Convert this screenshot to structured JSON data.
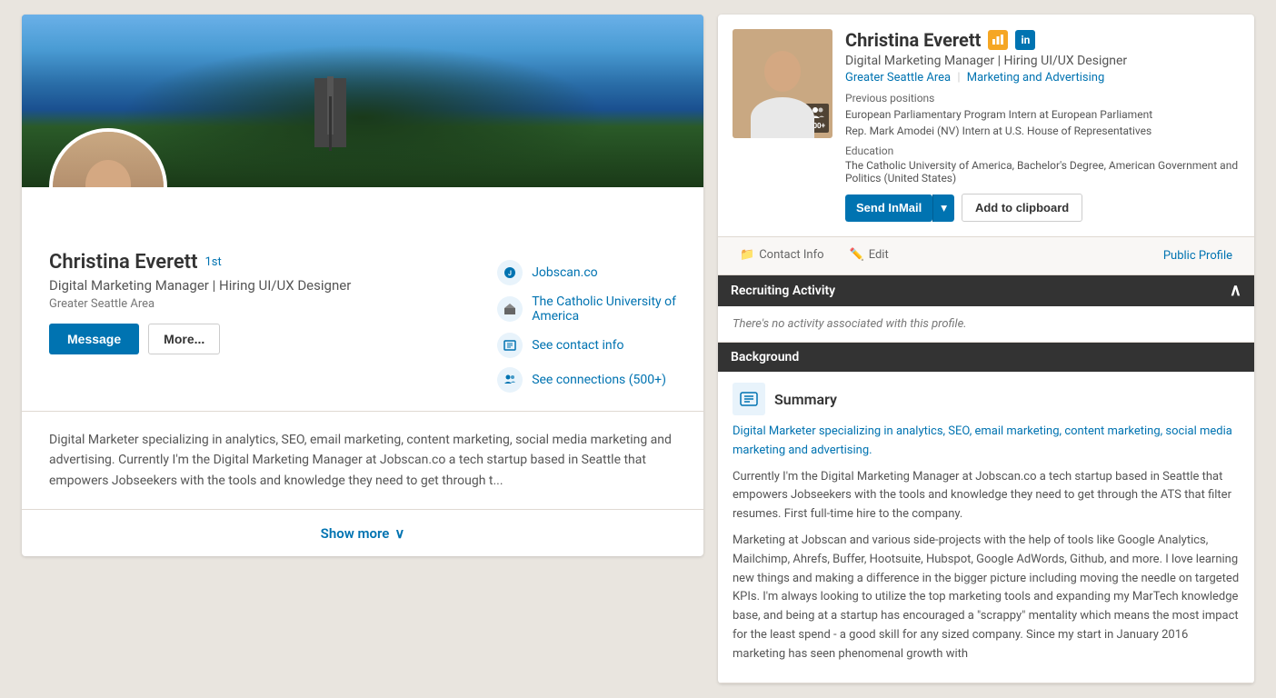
{
  "left": {
    "name": "Christina Everett",
    "connection": "1st",
    "headline": "Digital Marketing Manager | Hiring UI/UX Designer",
    "location": "Greater Seattle Area",
    "actions": {
      "message": "Message",
      "more": "More..."
    },
    "sidebar_links": [
      {
        "id": "jobscan",
        "label": "Jobscan.co",
        "icon": "🔵"
      },
      {
        "id": "university",
        "label": "The Catholic University of America",
        "icon": "🏛"
      },
      {
        "id": "contact",
        "label": "See contact info",
        "icon": "📋"
      },
      {
        "id": "connections",
        "label": "See connections (500+)",
        "icon": "👥"
      }
    ],
    "summary": "Digital Marketer specializing in analytics, SEO, email marketing, content marketing, social media marketing and advertising. Currently I'm the Digital Marketing Manager at Jobscan.co a tech startup based in Seattle that empowers Jobseekers with the tools and knowledge they need to get through t...",
    "show_more": "Show more"
  },
  "right": {
    "name": "Christina Everett",
    "headline": "Digital Marketing Manager | Hiring UI/UX Designer",
    "location_area": "Greater Seattle Area",
    "location_industry": "Marketing and Advertising",
    "previous_positions_label": "Previous positions",
    "previous_positions": [
      "European Parliamentary Program Intern at European Parliament",
      "Rep. Mark Amodei (NV) Intern at U.S. House of Representatives"
    ],
    "education_label": "Education",
    "education_text": "The Catholic University of America, Bachelor's Degree, American Government and Politics (United States)",
    "connections_count": "500+",
    "buttons": {
      "send_inmail": "Send InMail",
      "add_to_clipboard": "Add to clipboard"
    },
    "tabs": {
      "contact_info": "Contact Info",
      "edit": "Edit",
      "public_profile": "Public Profile"
    },
    "recruiting_activity_heading": "Recruiting Activity",
    "recruiting_activity_empty": "There's no activity associated with this profile.",
    "background_heading": "Background",
    "summary_heading": "Summary",
    "summary_p1_highlight": "Digital Marketer specializing in analytics, SEO, email marketing, content marketing, social media marketing and advertising.",
    "summary_p2": "Currently I'm the Digital Marketing Manager at Jobscan.co a tech startup based in Seattle that empowers Jobseekers with the tools and knowledge they need to get through the ATS that filter resumes. First full-time hire to the company.",
    "summary_p3": "Marketing at Jobscan and various side-projects with the help of tools like Google Analytics, Mailchimp, Ahrefs, Buffer, Hootsuite, Hubspot, Google AdWords, Github, and more. I love learning new things and making a difference in the bigger picture including moving the needle on targeted KPIs. I'm always looking to utilize the top marketing tools and expanding my MarTech knowledge base, and being at a startup has encouraged a \"scrappy\" mentality which means the most impact for the least spend - a good skill for any sized company. Since my start in January 2016 marketing has seen phenomenal growth with"
  }
}
